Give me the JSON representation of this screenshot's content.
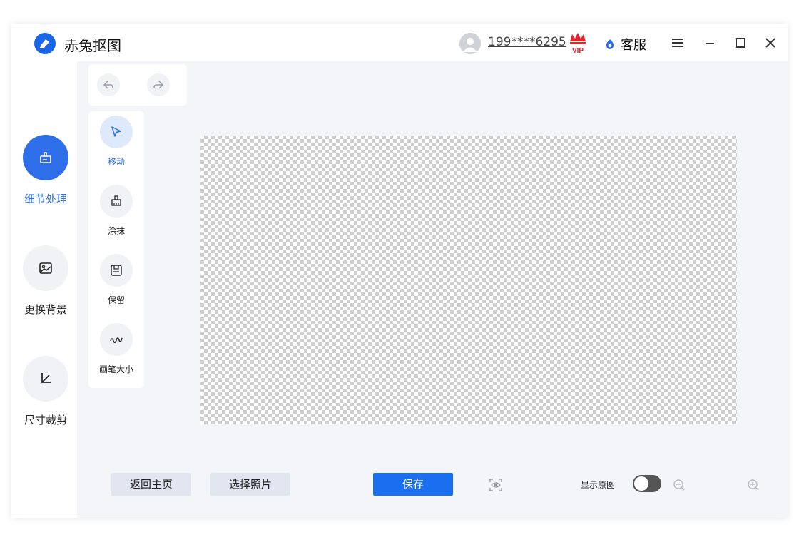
{
  "app": {
    "title": "赤兔抠图"
  },
  "header": {
    "phone": "199****6295",
    "vip_badge": "VIP",
    "customer_service": "客服"
  },
  "nav": {
    "items": [
      {
        "label": "细节处理",
        "icon": "hand-brush-icon",
        "active": true
      },
      {
        "label": "更换背景",
        "icon": "image-icon",
        "active": false
      },
      {
        "label": "尺寸裁剪",
        "icon": "crop-icon",
        "active": false
      }
    ]
  },
  "tools": {
    "items": [
      {
        "label": "移动",
        "icon": "cursor-arrow-icon",
        "active": true
      },
      {
        "label": "涂抹",
        "icon": "brush-icon",
        "active": false
      },
      {
        "label": "保留",
        "icon": "keep-icon",
        "active": false
      },
      {
        "label": "画笔大小",
        "icon": "brush-size-icon",
        "active": false
      }
    ]
  },
  "bottom": {
    "back_home": "返回主页",
    "select_photo": "选择照片",
    "save": "保存",
    "show_original": "显示原图",
    "show_original_on": false
  },
  "colors": {
    "accent": "#2e6ee8",
    "primary_button": "#1a6ff0",
    "workspace_bg": "#f4f5f9",
    "vip_red": "#e8212a"
  }
}
